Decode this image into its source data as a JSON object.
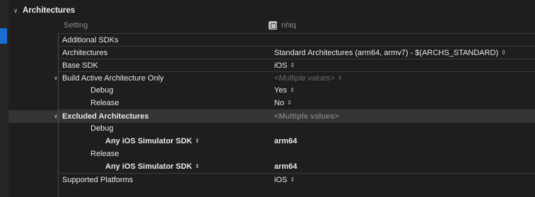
{
  "section": {
    "title": "Architectures"
  },
  "header": {
    "setting_label": "Setting",
    "target_name": "nhiq",
    "target_icon": "app-target-icon"
  },
  "rows": [
    {
      "label": "Additional SDKs",
      "value": ""
    },
    {
      "label": "Architectures",
      "value": "Standard Architectures (arm64, armv7)  -  $(ARCHS_STANDARD)"
    },
    {
      "label": "Base SDK",
      "value": "iOS"
    },
    {
      "label": "Build Active Architecture Only",
      "value": "<Multiple values>"
    },
    {
      "label": "Debug",
      "value": "Yes"
    },
    {
      "label": "Release",
      "value": "No"
    },
    {
      "label": "Excluded Architectures",
      "value": "<Multiple values>"
    },
    {
      "label": "Debug",
      "value": ""
    },
    {
      "label": "Any iOS Simulator SDK",
      "value": "arm64"
    },
    {
      "label": "Release",
      "value": ""
    },
    {
      "label": "Any iOS Simulator SDK",
      "value": "arm64"
    },
    {
      "label": "Supported Platforms",
      "value": "iOS"
    }
  ]
}
